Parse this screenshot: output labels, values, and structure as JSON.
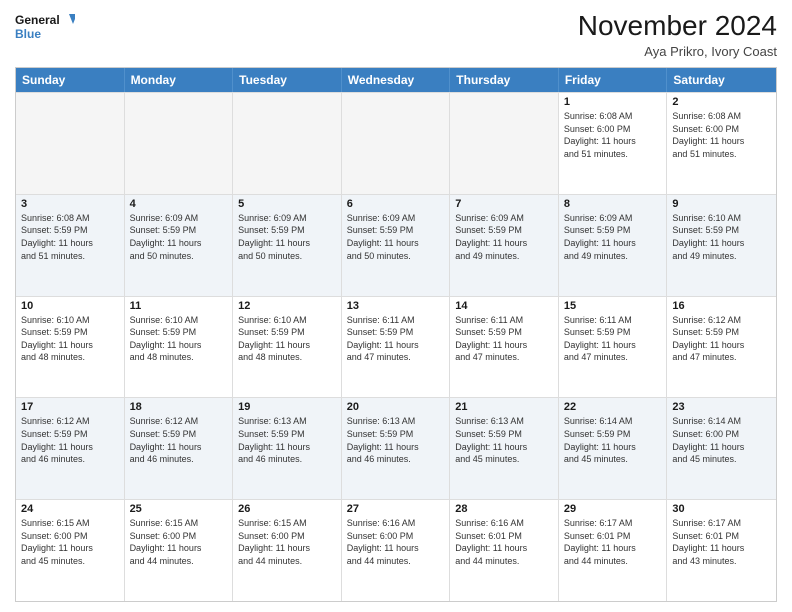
{
  "header": {
    "logo_line1": "General",
    "logo_line2": "Blue",
    "month_title": "November 2024",
    "location": "Aya Prikro, Ivory Coast"
  },
  "days_of_week": [
    "Sunday",
    "Monday",
    "Tuesday",
    "Wednesday",
    "Thursday",
    "Friday",
    "Saturday"
  ],
  "weeks": [
    [
      {
        "day": "",
        "empty": true,
        "lines": []
      },
      {
        "day": "",
        "empty": true,
        "lines": []
      },
      {
        "day": "",
        "empty": true,
        "lines": []
      },
      {
        "day": "",
        "empty": true,
        "lines": []
      },
      {
        "day": "",
        "empty": true,
        "lines": []
      },
      {
        "day": "1",
        "empty": false,
        "lines": [
          "Sunrise: 6:08 AM",
          "Sunset: 6:00 PM",
          "Daylight: 11 hours",
          "and 51 minutes."
        ]
      },
      {
        "day": "2",
        "empty": false,
        "lines": [
          "Sunrise: 6:08 AM",
          "Sunset: 6:00 PM",
          "Daylight: 11 hours",
          "and 51 minutes."
        ]
      }
    ],
    [
      {
        "day": "3",
        "empty": false,
        "lines": [
          "Sunrise: 6:08 AM",
          "Sunset: 5:59 PM",
          "Daylight: 11 hours",
          "and 51 minutes."
        ]
      },
      {
        "day": "4",
        "empty": false,
        "lines": [
          "Sunrise: 6:09 AM",
          "Sunset: 5:59 PM",
          "Daylight: 11 hours",
          "and 50 minutes."
        ]
      },
      {
        "day": "5",
        "empty": false,
        "lines": [
          "Sunrise: 6:09 AM",
          "Sunset: 5:59 PM",
          "Daylight: 11 hours",
          "and 50 minutes."
        ]
      },
      {
        "day": "6",
        "empty": false,
        "lines": [
          "Sunrise: 6:09 AM",
          "Sunset: 5:59 PM",
          "Daylight: 11 hours",
          "and 50 minutes."
        ]
      },
      {
        "day": "7",
        "empty": false,
        "lines": [
          "Sunrise: 6:09 AM",
          "Sunset: 5:59 PM",
          "Daylight: 11 hours",
          "and 49 minutes."
        ]
      },
      {
        "day": "8",
        "empty": false,
        "lines": [
          "Sunrise: 6:09 AM",
          "Sunset: 5:59 PM",
          "Daylight: 11 hours",
          "and 49 minutes."
        ]
      },
      {
        "day": "9",
        "empty": false,
        "lines": [
          "Sunrise: 6:10 AM",
          "Sunset: 5:59 PM",
          "Daylight: 11 hours",
          "and 49 minutes."
        ]
      }
    ],
    [
      {
        "day": "10",
        "empty": false,
        "lines": [
          "Sunrise: 6:10 AM",
          "Sunset: 5:59 PM",
          "Daylight: 11 hours",
          "and 48 minutes."
        ]
      },
      {
        "day": "11",
        "empty": false,
        "lines": [
          "Sunrise: 6:10 AM",
          "Sunset: 5:59 PM",
          "Daylight: 11 hours",
          "and 48 minutes."
        ]
      },
      {
        "day": "12",
        "empty": false,
        "lines": [
          "Sunrise: 6:10 AM",
          "Sunset: 5:59 PM",
          "Daylight: 11 hours",
          "and 48 minutes."
        ]
      },
      {
        "day": "13",
        "empty": false,
        "lines": [
          "Sunrise: 6:11 AM",
          "Sunset: 5:59 PM",
          "Daylight: 11 hours",
          "and 47 minutes."
        ]
      },
      {
        "day": "14",
        "empty": false,
        "lines": [
          "Sunrise: 6:11 AM",
          "Sunset: 5:59 PM",
          "Daylight: 11 hours",
          "and 47 minutes."
        ]
      },
      {
        "day": "15",
        "empty": false,
        "lines": [
          "Sunrise: 6:11 AM",
          "Sunset: 5:59 PM",
          "Daylight: 11 hours",
          "and 47 minutes."
        ]
      },
      {
        "day": "16",
        "empty": false,
        "lines": [
          "Sunrise: 6:12 AM",
          "Sunset: 5:59 PM",
          "Daylight: 11 hours",
          "and 47 minutes."
        ]
      }
    ],
    [
      {
        "day": "17",
        "empty": false,
        "lines": [
          "Sunrise: 6:12 AM",
          "Sunset: 5:59 PM",
          "Daylight: 11 hours",
          "and 46 minutes."
        ]
      },
      {
        "day": "18",
        "empty": false,
        "lines": [
          "Sunrise: 6:12 AM",
          "Sunset: 5:59 PM",
          "Daylight: 11 hours",
          "and 46 minutes."
        ]
      },
      {
        "day": "19",
        "empty": false,
        "lines": [
          "Sunrise: 6:13 AM",
          "Sunset: 5:59 PM",
          "Daylight: 11 hours",
          "and 46 minutes."
        ]
      },
      {
        "day": "20",
        "empty": false,
        "lines": [
          "Sunrise: 6:13 AM",
          "Sunset: 5:59 PM",
          "Daylight: 11 hours",
          "and 46 minutes."
        ]
      },
      {
        "day": "21",
        "empty": false,
        "lines": [
          "Sunrise: 6:13 AM",
          "Sunset: 5:59 PM",
          "Daylight: 11 hours",
          "and 45 minutes."
        ]
      },
      {
        "day": "22",
        "empty": false,
        "lines": [
          "Sunrise: 6:14 AM",
          "Sunset: 5:59 PM",
          "Daylight: 11 hours",
          "and 45 minutes."
        ]
      },
      {
        "day": "23",
        "empty": false,
        "lines": [
          "Sunrise: 6:14 AM",
          "Sunset: 6:00 PM",
          "Daylight: 11 hours",
          "and 45 minutes."
        ]
      }
    ],
    [
      {
        "day": "24",
        "empty": false,
        "lines": [
          "Sunrise: 6:15 AM",
          "Sunset: 6:00 PM",
          "Daylight: 11 hours",
          "and 45 minutes."
        ]
      },
      {
        "day": "25",
        "empty": false,
        "lines": [
          "Sunrise: 6:15 AM",
          "Sunset: 6:00 PM",
          "Daylight: 11 hours",
          "and 44 minutes."
        ]
      },
      {
        "day": "26",
        "empty": false,
        "lines": [
          "Sunrise: 6:15 AM",
          "Sunset: 6:00 PM",
          "Daylight: 11 hours",
          "and 44 minutes."
        ]
      },
      {
        "day": "27",
        "empty": false,
        "lines": [
          "Sunrise: 6:16 AM",
          "Sunset: 6:00 PM",
          "Daylight: 11 hours",
          "and 44 minutes."
        ]
      },
      {
        "day": "28",
        "empty": false,
        "lines": [
          "Sunrise: 6:16 AM",
          "Sunset: 6:01 PM",
          "Daylight: 11 hours",
          "and 44 minutes."
        ]
      },
      {
        "day": "29",
        "empty": false,
        "lines": [
          "Sunrise: 6:17 AM",
          "Sunset: 6:01 PM",
          "Daylight: 11 hours",
          "and 44 minutes."
        ]
      },
      {
        "day": "30",
        "empty": false,
        "lines": [
          "Sunrise: 6:17 AM",
          "Sunset: 6:01 PM",
          "Daylight: 11 hours",
          "and 43 minutes."
        ]
      }
    ]
  ]
}
